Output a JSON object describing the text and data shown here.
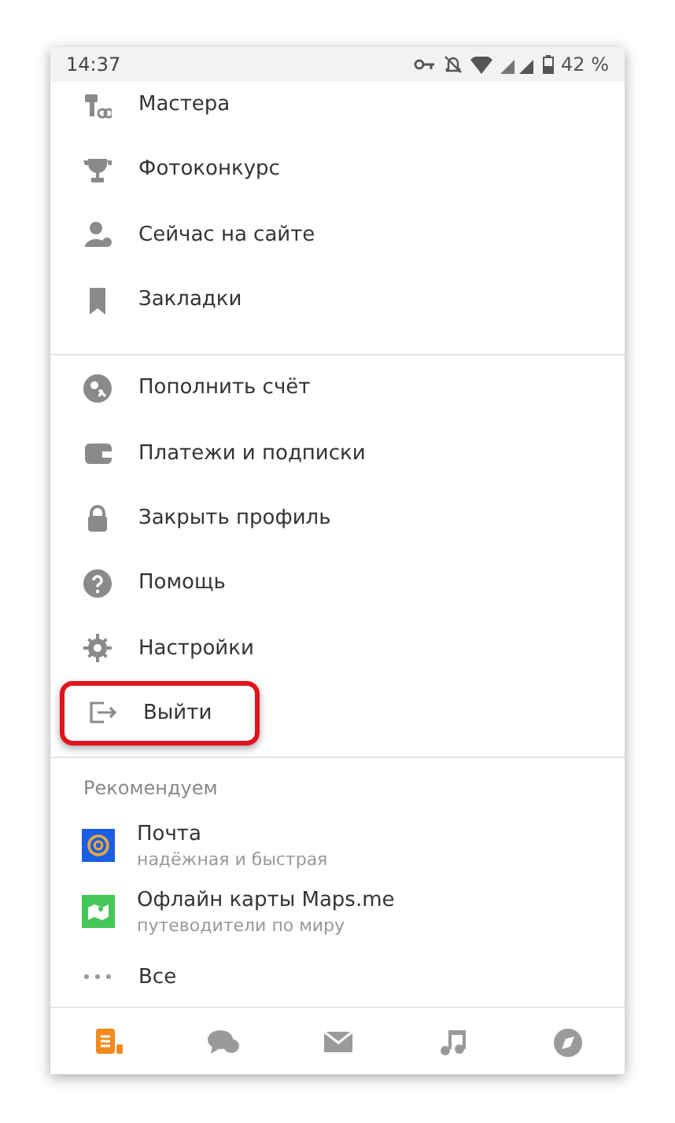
{
  "status_bar": {
    "time": "14:37",
    "battery": "42 %"
  },
  "sections": [
    {
      "items": [
        {
          "label": "Мастера",
          "highlighted": false
        },
        {
          "label": "Фотоконкурс",
          "highlighted": false
        },
        {
          "label": "Сейчас на сайте",
          "highlighted": false
        },
        {
          "label": "Закладки",
          "highlighted": false
        }
      ]
    },
    {
      "items": [
        {
          "label": "Пополнить счёт",
          "highlighted": false
        },
        {
          "label": "Платежи и подписки",
          "highlighted": false
        },
        {
          "label": "Закрыть профиль",
          "highlighted": false
        },
        {
          "label": "Помощь",
          "highlighted": false
        },
        {
          "label": "Настройки",
          "highlighted": false
        },
        {
          "label": "Выйти",
          "highlighted": true
        }
      ]
    }
  ],
  "recommended": {
    "title": "Рекомендуем",
    "apps": [
      {
        "name": "Почта",
        "subtitle": "надёжная и быстрая",
        "color": "#1a5ee6"
      },
      {
        "name": "Офлайн карты Maps.me",
        "subtitle": "путеводители по миру",
        "color": "#45c758"
      }
    ],
    "all": "Все"
  },
  "bottom_nav": [
    {
      "selected": true
    },
    {
      "selected": false
    },
    {
      "selected": false
    },
    {
      "selected": false
    },
    {
      "selected": false
    }
  ]
}
